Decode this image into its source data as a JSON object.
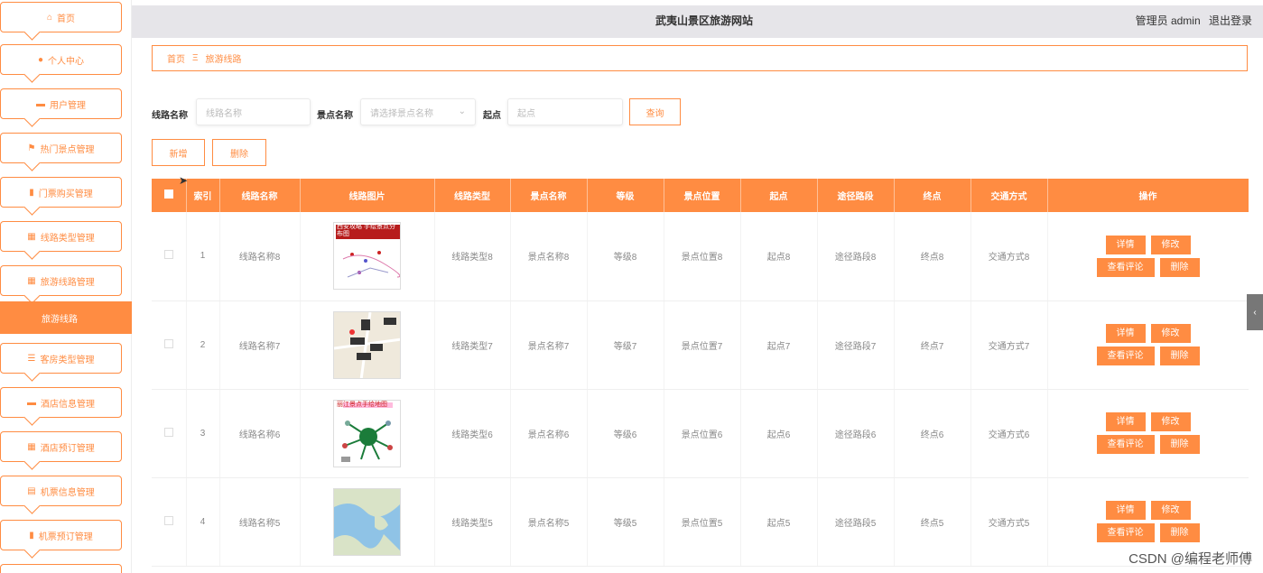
{
  "header": {
    "site_title": "武夷山景区旅游网站",
    "user_label": "管理员 admin",
    "logout": "退出登录"
  },
  "sidebar": {
    "items": [
      {
        "label": "首页",
        "icon": "home-icon",
        "glyph": "⌂"
      },
      {
        "label": "个人中心",
        "icon": "user-icon",
        "glyph": "●"
      },
      {
        "label": "用户管理",
        "icon": "briefcase-icon",
        "glyph": "▬"
      },
      {
        "label": "热门景点管理",
        "icon": "flag-icon",
        "glyph": "⚑"
      },
      {
        "label": "门票购买管理",
        "icon": "chart-icon",
        "glyph": "▮"
      },
      {
        "label": "线路类型管理",
        "icon": "grid-icon",
        "glyph": "▦"
      },
      {
        "label": "旅游线路管理",
        "icon": "grid-icon",
        "glyph": "▦"
      }
    ],
    "active_sub": "旅游线路",
    "items_after": [
      {
        "label": "客房类型管理",
        "icon": "list-icon",
        "glyph": "☰"
      },
      {
        "label": "酒店信息管理",
        "icon": "comment-icon",
        "glyph": "▬"
      },
      {
        "label": "酒店预订管理",
        "icon": "grid-icon",
        "glyph": "▦"
      },
      {
        "label": "机票信息管理",
        "icon": "document-icon",
        "glyph": "▤"
      },
      {
        "label": "机票预订管理",
        "icon": "bar-chart-icon",
        "glyph": "▮"
      }
    ]
  },
  "breadcrumb": {
    "home": "首页",
    "separator": "Ξ",
    "current": "旅游线路"
  },
  "search": {
    "route_name_label": "线路名称",
    "route_name_placeholder": "线路名称",
    "spot_name_label": "景点名称",
    "spot_name_placeholder": "请选择景点名称",
    "start_label": "起点",
    "start_placeholder": "起点",
    "query_button": "查询"
  },
  "toolbar": {
    "add_button": "新增",
    "delete_button": "删除"
  },
  "table": {
    "columns": [
      "索引",
      "线路名称",
      "线路图片",
      "线路类型",
      "景点名称",
      "等级",
      "景点位置",
      "起点",
      "途径路段",
      "终点",
      "交通方式",
      "操作"
    ],
    "actions": {
      "detail": "详情",
      "edit": "修改",
      "reviews": "查看评论",
      "delete": "删除"
    },
    "rows": [
      {
        "index": "1",
        "route_name": "线路名称8",
        "route_type": "线路类型8",
        "spot_name": "景点名称8",
        "level": "等级8",
        "spot_location": "景点位置8",
        "start": "起点8",
        "via": "途径路段8",
        "end": "终点8",
        "transport": "交通方式8",
        "image_caption": "西安攻略 手绘景点分布图"
      },
      {
        "index": "2",
        "route_name": "线路名称7",
        "route_type": "线路类型7",
        "spot_name": "景点名称7",
        "level": "等级7",
        "spot_location": "景点位置7",
        "start": "起点7",
        "via": "途径路段7",
        "end": "终点7",
        "transport": "交通方式7",
        "image_caption": ""
      },
      {
        "index": "3",
        "route_name": "线路名称6",
        "route_type": "线路类型6",
        "spot_name": "景点名称6",
        "level": "等级6",
        "spot_location": "景点位置6",
        "start": "起点6",
        "via": "途径路段6",
        "end": "终点6",
        "transport": "交通方式6",
        "image_caption": "丽江景点手绘地图"
      },
      {
        "index": "4",
        "route_name": "线路名称5",
        "route_type": "线路类型5",
        "spot_name": "景点名称5",
        "level": "等级5",
        "spot_location": "景点位置5",
        "start": "起点5",
        "via": "途径路段5",
        "end": "终点5",
        "transport": "交通方式5",
        "image_caption": ""
      }
    ]
  },
  "side_tab": "‹",
  "watermark": "CSDN @编程老师傅",
  "colors": {
    "accent": "#ff8c42",
    "header_bg": "#e6e5e9"
  }
}
